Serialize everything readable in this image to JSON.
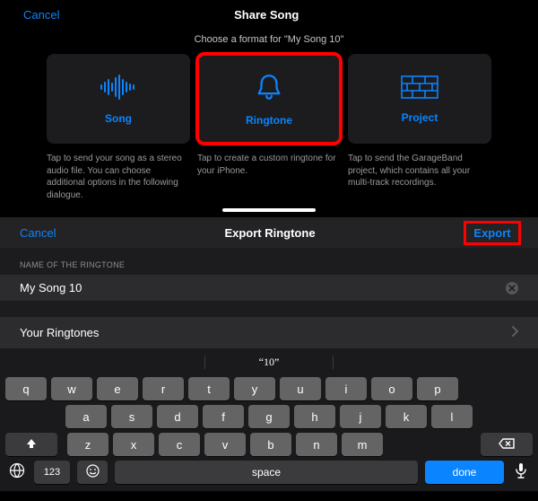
{
  "share": {
    "cancel": "Cancel",
    "title": "Share Song",
    "subtitle": "Choose a format for \"My Song 10\"",
    "cards": [
      {
        "label": "Song",
        "desc": "Tap to send your song as a stereo audio file. You can choose additional options in the following dialogue."
      },
      {
        "label": "Ringtone",
        "desc": "Tap to create a custom ringtone for your iPhone."
      },
      {
        "label": "Project",
        "desc": "Tap to send the GarageBand project, which contains all your multi-track recordings."
      }
    ]
  },
  "export": {
    "cancel": "Cancel",
    "title": "Export Ringtone",
    "action": "Export",
    "section_label": "NAME OF THE RINGTONE",
    "name": "My Song 10",
    "link": "Your Ringtones"
  },
  "keyboard": {
    "suggestion": "“10”",
    "row1": [
      "q",
      "w",
      "e",
      "r",
      "t",
      "y",
      "u",
      "i",
      "o",
      "p"
    ],
    "row2": [
      "a",
      "s",
      "d",
      "f",
      "g",
      "h",
      "j",
      "k",
      "l"
    ],
    "row3": [
      "z",
      "x",
      "c",
      "v",
      "b",
      "n",
      "m"
    ],
    "numkey": "123",
    "space": "space",
    "done": "done"
  }
}
